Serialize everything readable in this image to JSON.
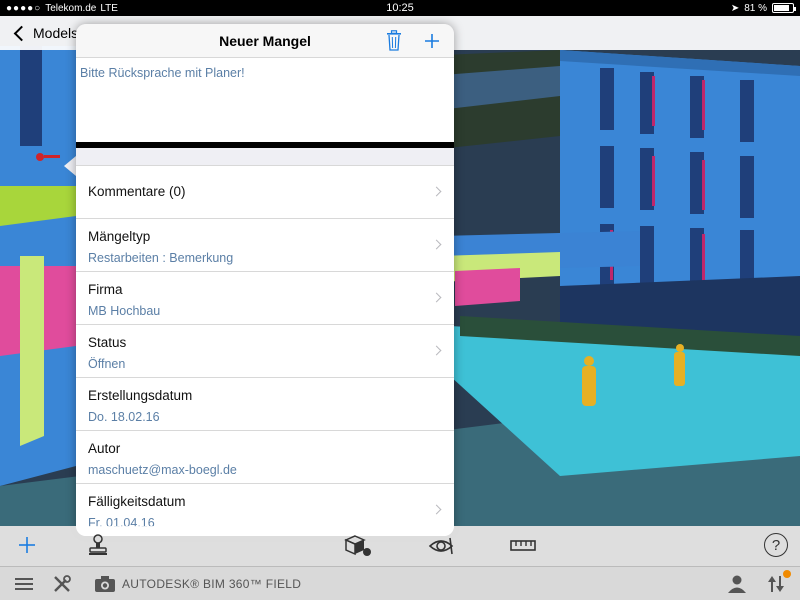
{
  "statusbar": {
    "carrier": "Telekom.de",
    "network": "LTE",
    "time": "10:25",
    "battery": "81 %",
    "battery_level": 0.81
  },
  "nav": {
    "back_label": "Models"
  },
  "popover": {
    "title": "Neuer Mangel",
    "note_text": "Bitte Rücksprache mit Planer!",
    "comments_label": "Kommentare (0)",
    "fields": [
      {
        "label": "Mängeltyp",
        "value": "Restarbeiten : Bemerkung"
      },
      {
        "label": "Firma",
        "value": "MB Hochbau"
      },
      {
        "label": "Status",
        "value": "Öffnen"
      },
      {
        "label": "Erstellungsdatum",
        "value": "Do. 18.02.16"
      },
      {
        "label": "Autor",
        "value": "maschuetz@max-boegl.de"
      },
      {
        "label": "Fälligkeitsdatum",
        "value": "Fr. 01.04.16"
      }
    ]
  },
  "bottombar": {
    "brand": "AUTODESK® BIM 360™ FIELD",
    "help_label": "?"
  },
  "colors": {
    "accent": "#1a7ce0",
    "value_text": "#5b7fa6",
    "notification": "#f08a00"
  }
}
